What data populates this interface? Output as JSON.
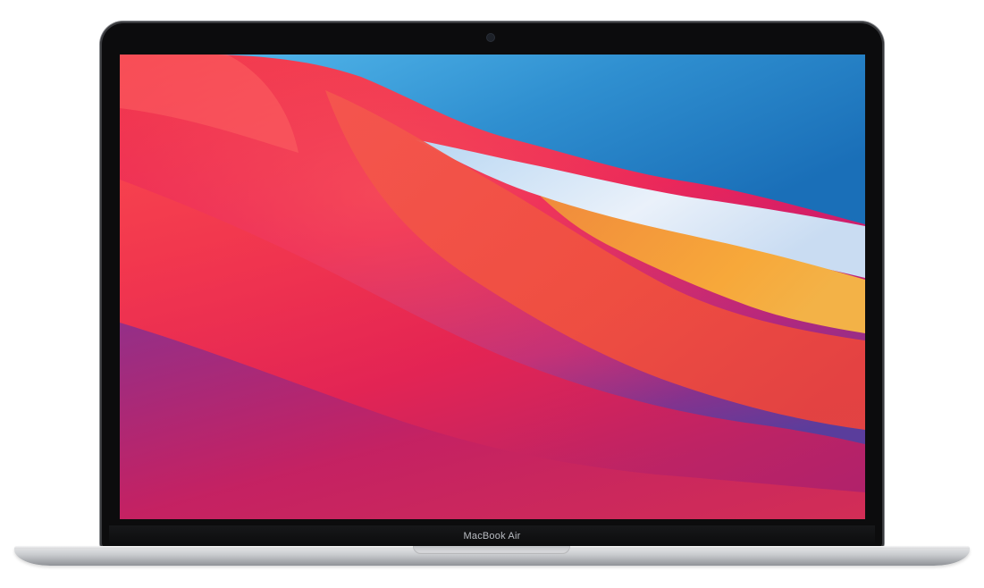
{
  "device": {
    "model_label": "MacBook Air"
  },
  "colors": {
    "wallpaper_red": "#e8194a",
    "wallpaper_magenta": "#c2247e",
    "wallpaper_purple": "#6a3fa0",
    "wallpaper_blue": "#1f7cc4",
    "wallpaper_sky": "#3fa7e0",
    "wallpaper_white": "#dde8f6",
    "wallpaper_orange": "#f4a13a",
    "wallpaper_coral": "#f2554a",
    "bezel": "#0c0c0d",
    "aluminium": "#c9cbce"
  }
}
